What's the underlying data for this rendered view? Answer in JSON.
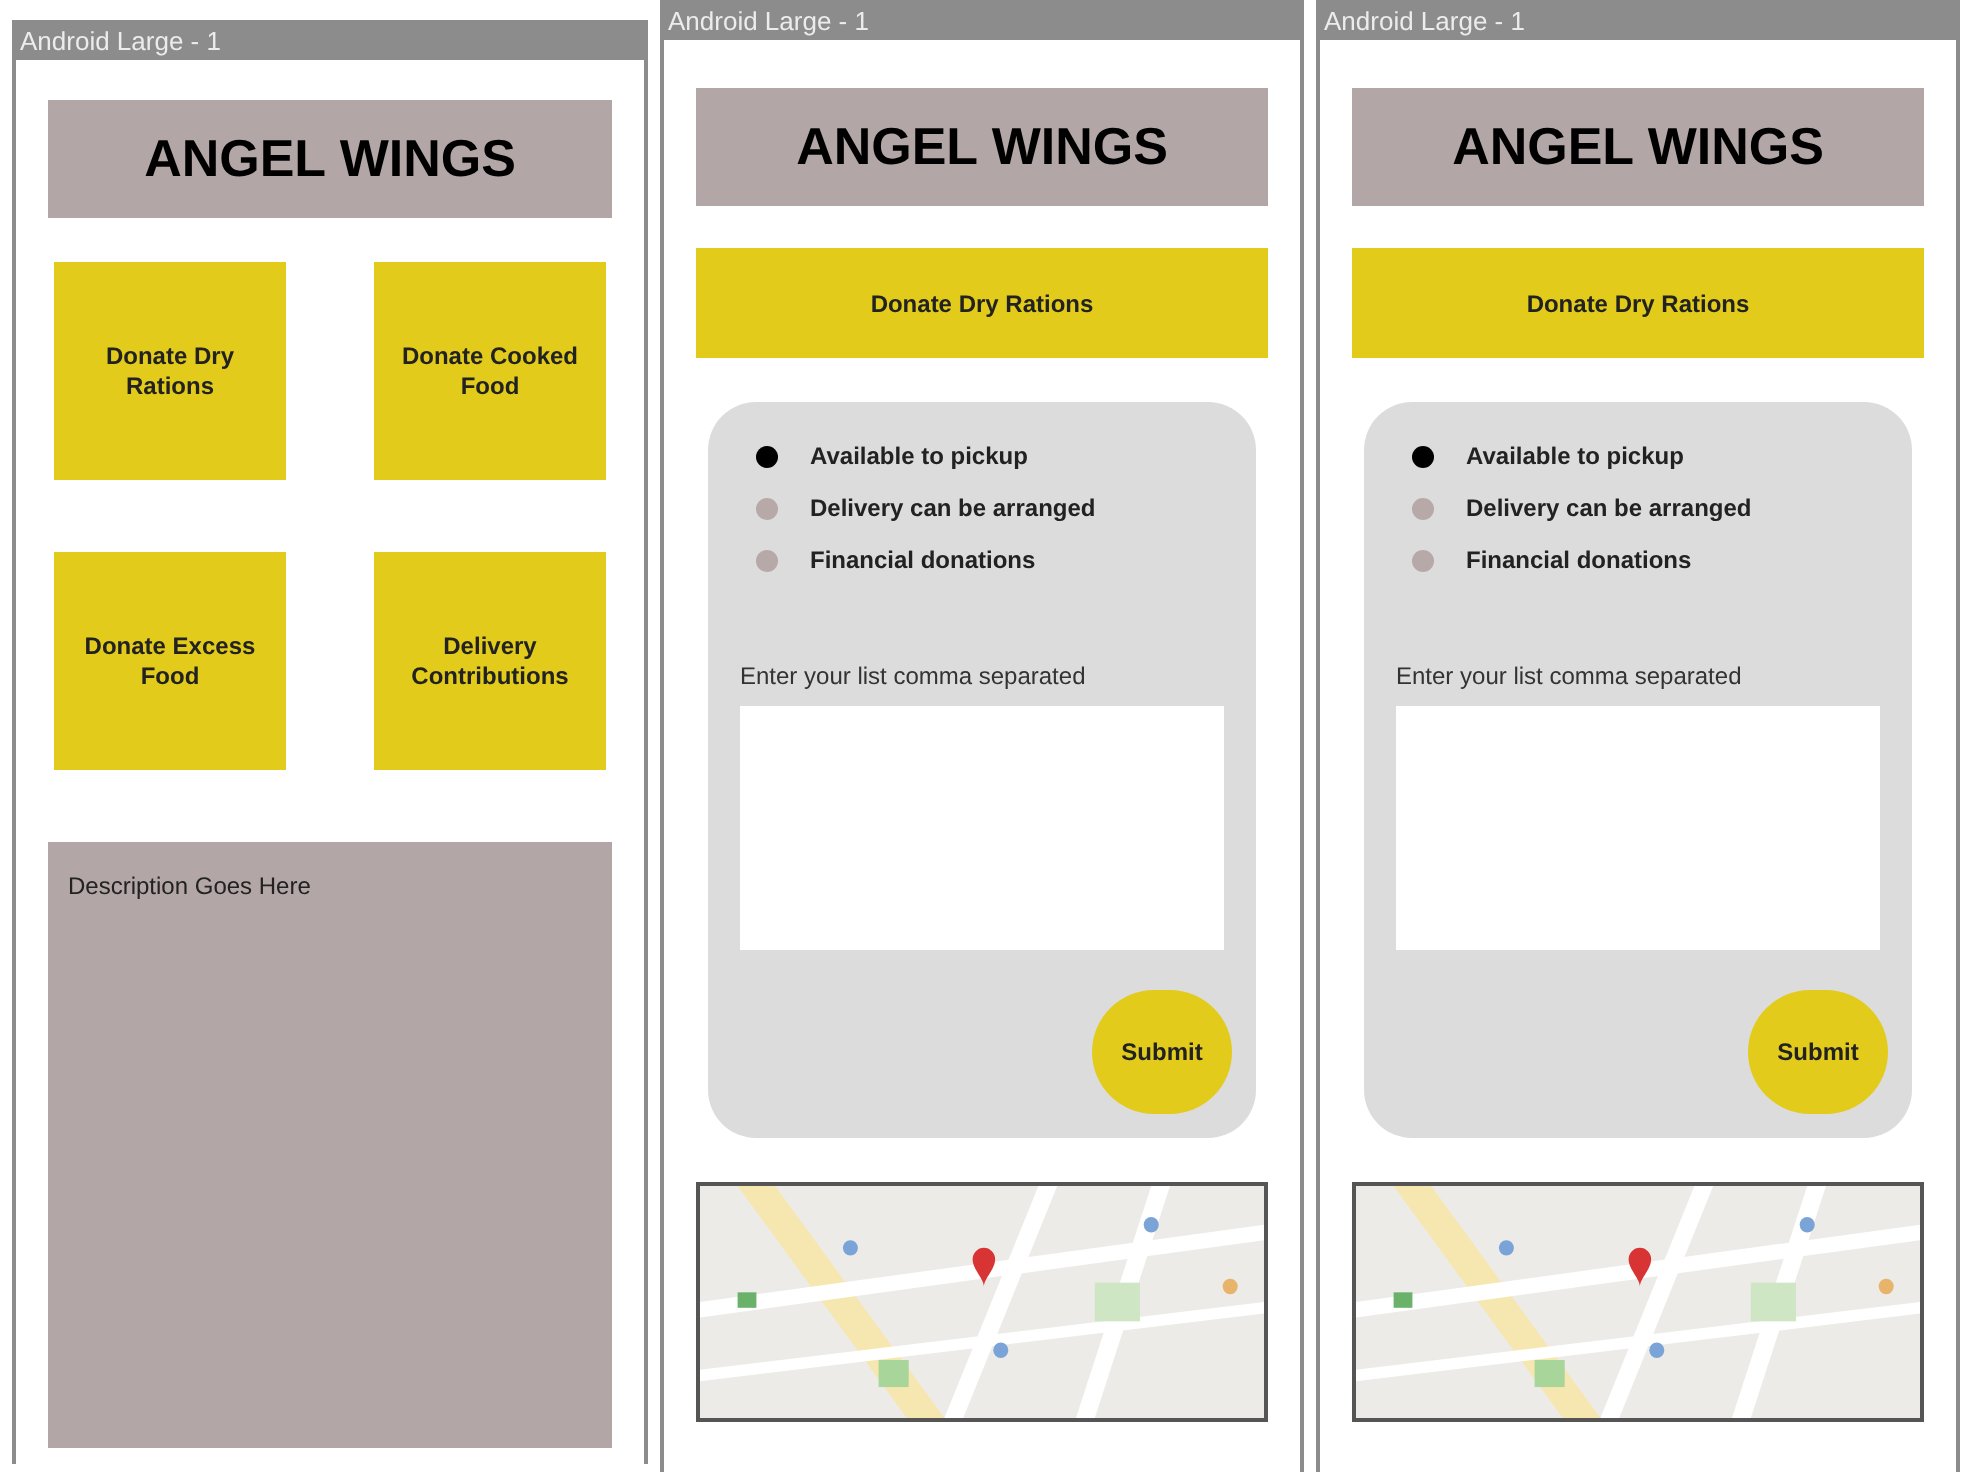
{
  "frames": [
    {
      "title": "Android Large - 1",
      "kind": "home",
      "header": "ANGEL WINGS",
      "tiles": [
        "Donate Dry Rations",
        "Donate Cooked Food",
        "Donate Excess Food",
        "Delivery Contributions"
      ],
      "description": "Description Goes Here"
    },
    {
      "title": "Android Large - 1",
      "kind": "form",
      "header": "ANGEL WINGS",
      "action": "Donate Dry Rations",
      "options": [
        {
          "label": "Available to pickup",
          "selected": true
        },
        {
          "label": "Delivery can be arranged",
          "selected": false
        },
        {
          "label": "Financial donations",
          "selected": false
        }
      ],
      "field_label": "Enter your list comma separated",
      "submit": "Submit"
    },
    {
      "title": "Android Large - 1",
      "kind": "form",
      "header": "ANGEL WINGS",
      "action": "Donate Dry Rations",
      "options": [
        {
          "label": "Available to pickup",
          "selected": true
        },
        {
          "label": "Delivery can be arranged",
          "selected": false
        },
        {
          "label": "Financial donations",
          "selected": false
        }
      ],
      "field_label": "Enter your list comma separated",
      "submit": "Submit"
    }
  ]
}
